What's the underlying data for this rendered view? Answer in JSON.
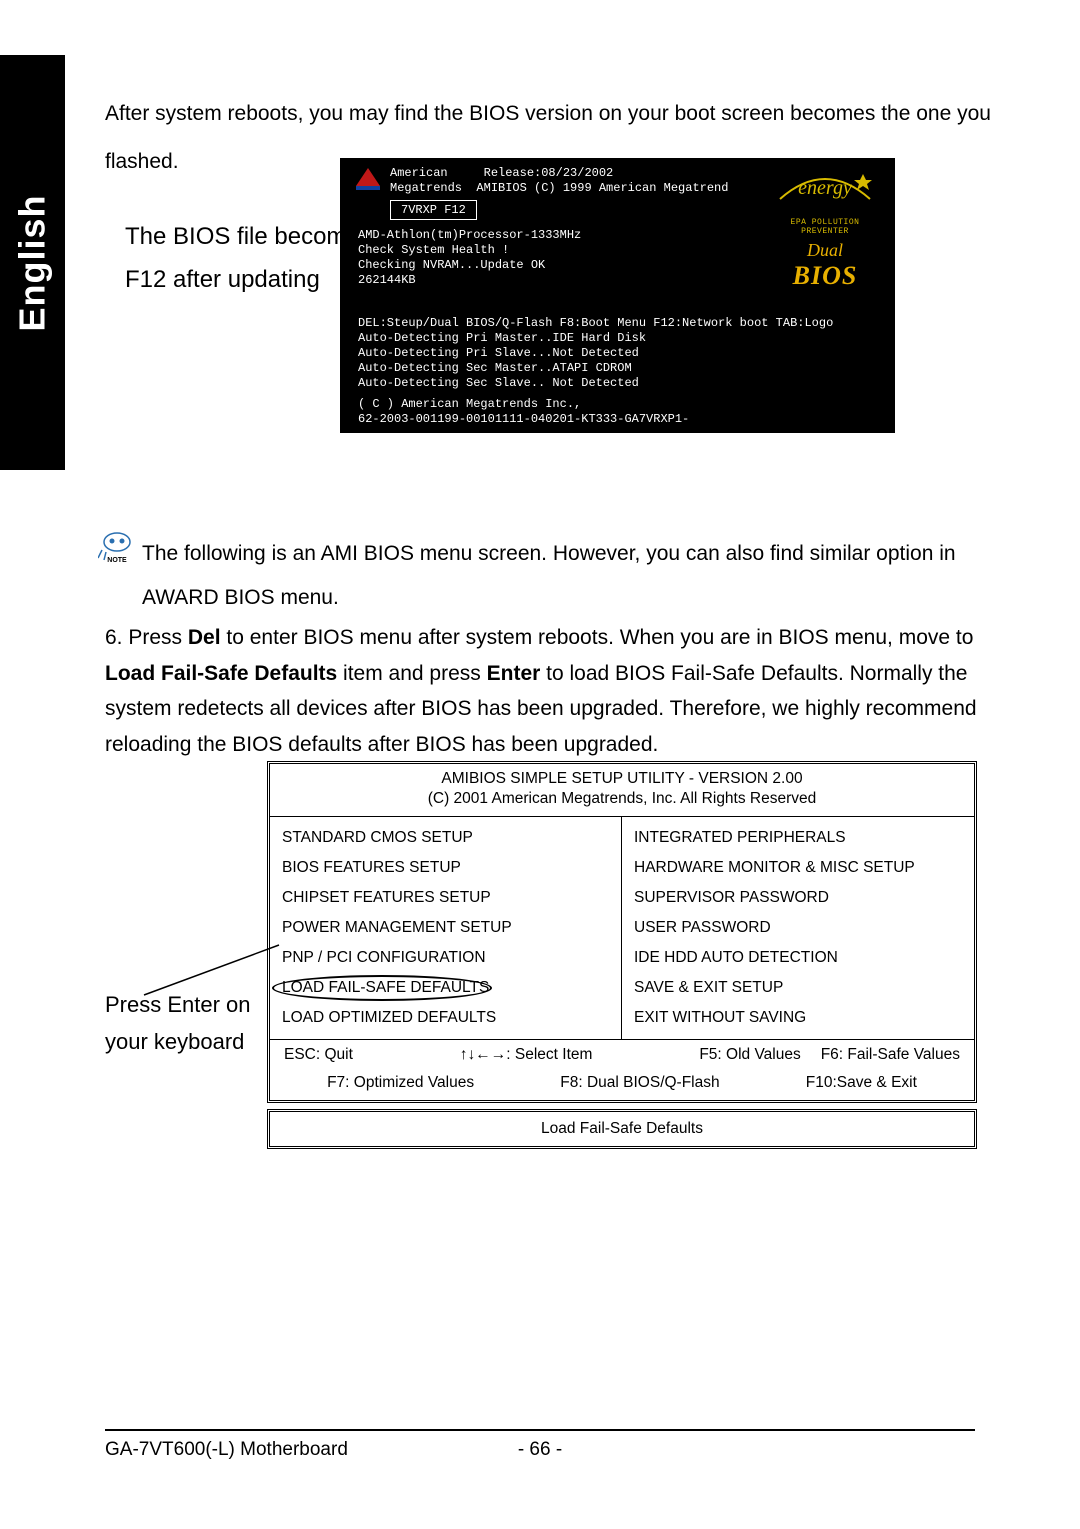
{
  "lang_tab": "English",
  "intro": "After system reboots, you may find the BIOS version on your boot screen becomes the one you flashed.",
  "annotation1_l1": "The BIOS file becomes",
  "annotation1_l2": "F12 after updating",
  "bios": {
    "hdr_brand1": "American",
    "hdr_release": "Release:08/23/2002",
    "hdr_brand2": "Megatrends",
    "hdr_ami": "AMIBIOS (C) 1999 American Megatrend",
    "version_box": "7VRXP F12",
    "cpu": "AMD-Athlon(tm)Processor-1333MHz",
    "health": "Check System Health !",
    "nvram": "Checking NVRAM...Update OK",
    "mem": "262144KB",
    "boot_hint": "DEL:Steup/Dual BIOS/Q-Flash F8:Boot Menu F12:Network boot TAB:Logo",
    "det1": "Auto-Detecting Pri Master..IDE Hard Disk",
    "det2": "Auto-Detecting Pri Slave...Not Detected",
    "det3": "Auto-Detecting Sec Master..ATAPI CDROM",
    "det4": "Auto-Detecting Sec Slave.. Not Detected",
    "copyright": "( C ) American Megatrends Inc.,",
    "serial": "62-2003-001199-00101111-040201-KT333-GA7VRXP1-",
    "epa": "EPA  POLLUTION PREVENTER",
    "dual": "Dual",
    "bios_word": "BIOS"
  },
  "note_label": "NOTE",
  "note_text": "The following is an AMI BIOS menu screen. However, you can also find similar option in AWARD BIOS menu.",
  "step6_prefix": "6. Press ",
  "step6_del": "Del",
  "step6_mid1": " to enter BIOS menu after system reboots. When you are in BIOS menu, move to ",
  "step6_lfs": "Load Fail-Safe Defaults",
  "step6_mid2": " item and press ",
  "step6_enter": "Enter",
  "step6_tail": " to load BIOS Fail-Safe Defaults. Normally the system redetects all devices after BIOS has been upgraded. Therefore, we highly recommend reloading the BIOS defaults after BIOS has been upgraded.",
  "ami_menu": {
    "title": "AMIBIOS SIMPLE SETUP UTILITY - VERSION 2.00",
    "copyright": "(C) 2001 American Megatrends, Inc. All Rights Reserved",
    "left": [
      "STANDARD CMOS SETUP",
      "BIOS FEATURES SETUP",
      "CHIPSET FEATURES SETUP",
      "POWER MANAGEMENT SETUP",
      "PNP / PCI CONFIGURATION",
      "LOAD FAIL-SAFE DEFAULTS",
      "LOAD OPTIMIZED DEFAULTS"
    ],
    "right": [
      "INTEGRATED PERIPHERALS",
      "HARDWARE MONITOR & MISC SETUP",
      "SUPERVISOR PASSWORD",
      "USER PASSWORD",
      "IDE HDD AUTO DETECTION",
      "SAVE & EXIT SETUP",
      "EXIT WITHOUT SAVING"
    ],
    "hint_esc": "ESC: Quit",
    "hint_arrows": "↑↓←→: Select Item",
    "hint_f5": "F5: Old Values",
    "hint_f6": "F6: Fail-Safe Values",
    "hint_f7": "F7: Optimized Values",
    "hint_f8": "F8: Dual BIOS/Q-Flash",
    "hint_f10": "F10:Save & Exit",
    "footer_prompt": "Load Fail-Safe Defaults"
  },
  "press_enter_l1": "Press Enter on",
  "press_enter_l2": "your keyboard",
  "footer_model": "GA-7VT600(-L) Motherboard",
  "footer_page": "- 66 -"
}
